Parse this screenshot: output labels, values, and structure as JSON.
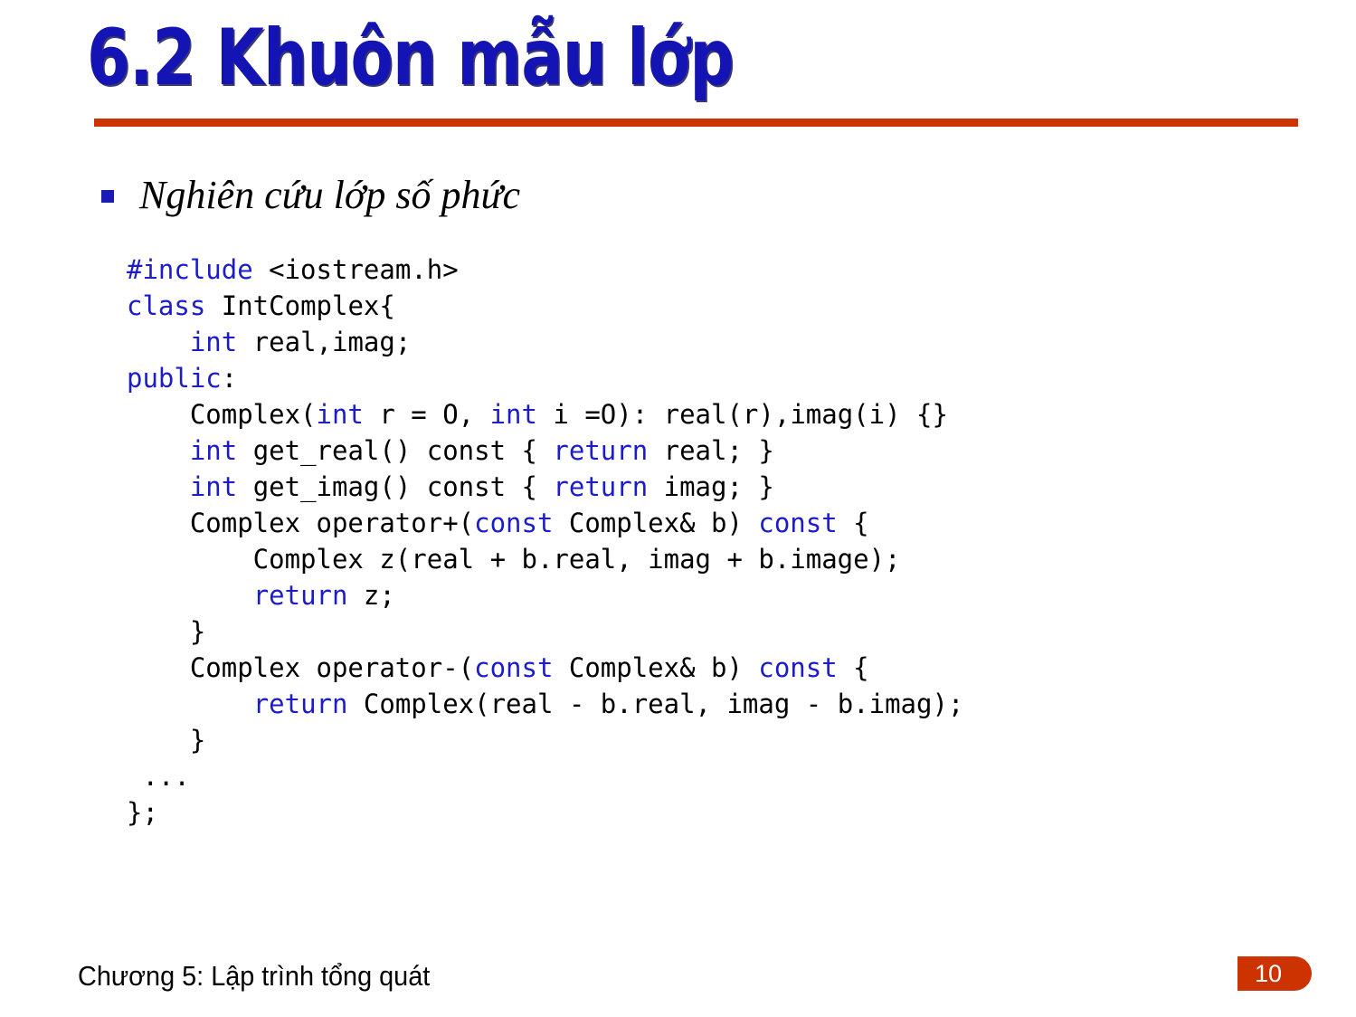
{
  "slide": {
    "title": "6.2 Khuôn mẫu lớp",
    "title_color": "#1414b4",
    "rule_color": "#cc3300",
    "background_color": "#ffffff"
  },
  "bullet": {
    "marker": "square-bullet",
    "marker_color": "#1a1ab4",
    "text": "Nghiên cứu lớp số phức"
  },
  "code": {
    "keyword_color": "#1c1cc8",
    "text_color": "#000000",
    "lines": [
      [
        {
          "t": "#include ",
          "k": true
        },
        {
          "t": "<iostream.h>",
          "k": false
        }
      ],
      [
        {
          "t": "class ",
          "k": true
        },
        {
          "t": "IntComplex{",
          "k": false
        }
      ],
      [
        {
          "t": "    ",
          "k": false
        },
        {
          "t": "int ",
          "k": true
        },
        {
          "t": "real,imag;",
          "k": false
        }
      ],
      [
        {
          "t": "public",
          "k": true
        },
        {
          "t": ":",
          "k": false
        }
      ],
      [
        {
          "t": "    Complex(",
          "k": false
        },
        {
          "t": "int ",
          "k": true
        },
        {
          "t": "r = O, ",
          "k": false
        },
        {
          "t": "int ",
          "k": true
        },
        {
          "t": "i =O): real(r),imag(i) {}",
          "k": false
        }
      ],
      [
        {
          "t": "    ",
          "k": false
        },
        {
          "t": "int ",
          "k": true
        },
        {
          "t": "get_real() const { ",
          "k": false
        },
        {
          "t": "return ",
          "k": true
        },
        {
          "t": "real; }",
          "k": false
        }
      ],
      [
        {
          "t": "    ",
          "k": false
        },
        {
          "t": "int ",
          "k": true
        },
        {
          "t": "get_imag() const { ",
          "k": false
        },
        {
          "t": "return ",
          "k": true
        },
        {
          "t": "imag; }",
          "k": false
        }
      ],
      [
        {
          "t": "    Complex operator+(",
          "k": false
        },
        {
          "t": "const ",
          "k": true
        },
        {
          "t": "Complex& b) ",
          "k": false
        },
        {
          "t": "const ",
          "k": true
        },
        {
          "t": "{",
          "k": false
        }
      ],
      [
        {
          "t": "        Complex z(real + b.real, imag + b.image);",
          "k": false
        }
      ],
      [
        {
          "t": "        ",
          "k": false
        },
        {
          "t": "return ",
          "k": true
        },
        {
          "t": "z;",
          "k": false
        }
      ],
      [
        {
          "t": "    }",
          "k": false
        }
      ],
      [
        {
          "t": "    Complex operator-(",
          "k": false
        },
        {
          "t": "const ",
          "k": true
        },
        {
          "t": "Complex& b) ",
          "k": false
        },
        {
          "t": "const ",
          "k": true
        },
        {
          "t": "{",
          "k": false
        }
      ],
      [
        {
          "t": "        ",
          "k": false
        },
        {
          "t": "return ",
          "k": true
        },
        {
          "t": "Complex(real - b.real, imag - b.imag);",
          "k": false
        }
      ],
      [
        {
          "t": "    }",
          "k": false
        }
      ],
      [
        {
          "t": " ...",
          "k": false
        }
      ],
      [
        {
          "t": "};",
          "k": false
        }
      ]
    ]
  },
  "footer": {
    "text": "Chương 5: Lập trình tổng quát",
    "page_number": "10",
    "page_badge_color": "#cc3300"
  }
}
